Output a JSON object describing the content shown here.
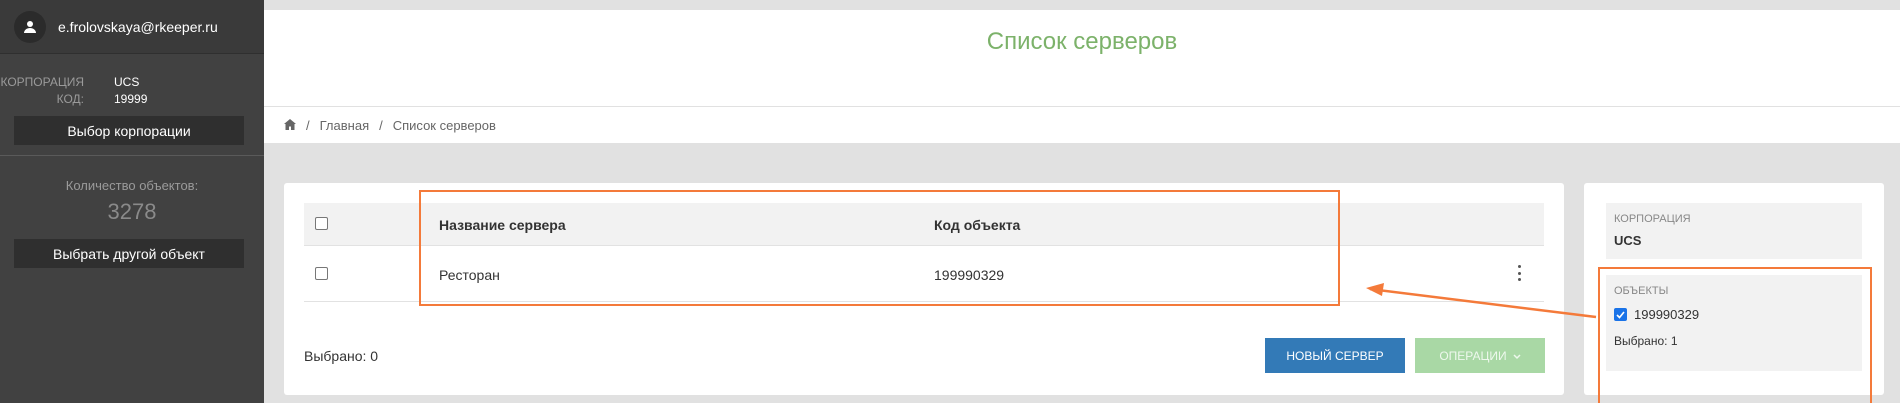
{
  "sidebar": {
    "user_email": "e.frolovskaya@rkeeper.ru",
    "corp_label": "КОРПОРАЦИЯ",
    "corp_value": "UCS",
    "code_label": "КОД:",
    "code_value": "19999",
    "select_corp_button": "Выбор корпорации",
    "objects_count_label": "Количество объектов:",
    "objects_count": "3278",
    "select_object_button": "Выбрать другой объект"
  },
  "header": {
    "title": "Список серверов"
  },
  "breadcrumb": {
    "home": "Главная",
    "current": "Список серверов",
    "separator": "/"
  },
  "table": {
    "columns": [
      "Название сервера",
      "Код объекта"
    ],
    "rows": [
      {
        "name": "Ресторан",
        "code": "199990329"
      }
    ]
  },
  "footer": {
    "selected_text": "Выбрано: 0",
    "new_server_button": "НОВЫЙ СЕРВЕР",
    "operations_button": "ОПЕРАЦИИ"
  },
  "filter": {
    "corp_label": "КОРПОРАЦИЯ",
    "corp_value": "UCS",
    "objects_label": "ОБЪЕКТЫ",
    "objects": [
      {
        "code": "199990329",
        "checked": true
      }
    ],
    "selected_text": "Выбрано: 1"
  },
  "colors": {
    "sidebar_bg": "#414141",
    "title_green": "#7cb26a",
    "primary_blue": "#337ab7",
    "disabled_green": "#a9d8a5",
    "annotation_orange": "#f47a3a"
  }
}
